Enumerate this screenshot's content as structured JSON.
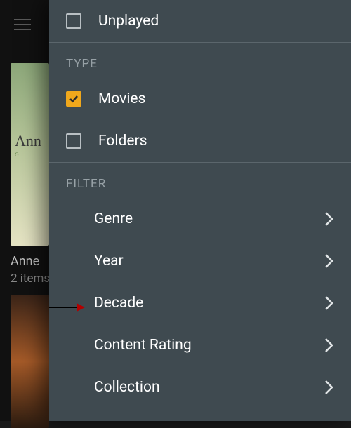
{
  "backdrop": {
    "poster1_title": "Ann",
    "poster1_sub": "G",
    "item_title": "Anne",
    "item_subtitle": "2 items"
  },
  "panel": {
    "options": {
      "unplayed": {
        "label": "Unplayed",
        "checked": false
      }
    },
    "type_header": "TYPE",
    "types": {
      "movies": {
        "label": "Movies",
        "checked": true
      },
      "folders": {
        "label": "Folders",
        "checked": false
      }
    },
    "filter_header": "FILTER",
    "filters": [
      {
        "key": "genre",
        "label": "Genre"
      },
      {
        "key": "year",
        "label": "Year"
      },
      {
        "key": "decade",
        "label": "Decade"
      },
      {
        "key": "content_rating",
        "label": "Content Rating"
      },
      {
        "key": "collection",
        "label": "Collection"
      }
    ]
  }
}
